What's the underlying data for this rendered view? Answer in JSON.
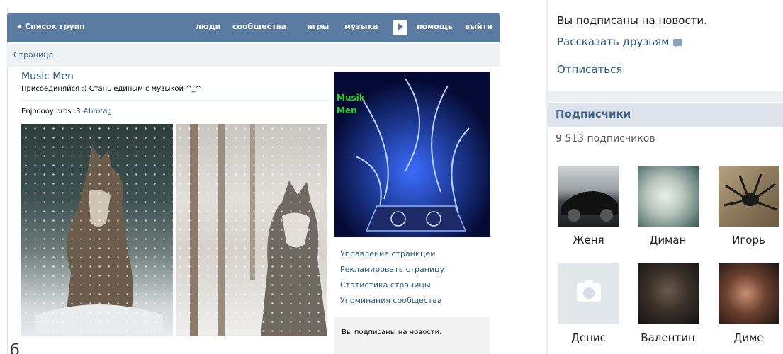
{
  "topbar": {
    "back_label": "Список групп",
    "nav": [
      "люди",
      "сообщества",
      "игры",
      "музыка",
      "помощь",
      "выйти"
    ]
  },
  "breadcrumb": "Страница",
  "group": {
    "name": "Music Men",
    "status": "Присоединяйся :) Стань единым с музыкой ^_^",
    "post_text": "Enjoooоy bros :3 ",
    "post_tag": "#brotag",
    "avatar_text": [
      "Musik",
      "Men"
    ]
  },
  "sidebar_links": [
    "Управление страницей",
    "Рекламировать страницу",
    "Статистика страницы",
    "Упоминания сообщества"
  ],
  "subscribed_small": "Вы подписаны на новости.",
  "bottom_glyph": "б",
  "right_panel": {
    "subscribed": "Вы подписаны на новости.",
    "tell_friends": "Рассказать друзьям",
    "unsubscribe": "Отписаться",
    "subscribers_title": "Подписчики",
    "subscribers_count": "9 513 подписчиков",
    "subscribers": [
      "Женя",
      "Диман",
      "Игорь",
      "Денис",
      "Валентин",
      "Диме"
    ]
  },
  "colors": {
    "vk_blue": "#5b7ca1",
    "link": "#2b587a",
    "header_bg": "#dde4eb"
  }
}
